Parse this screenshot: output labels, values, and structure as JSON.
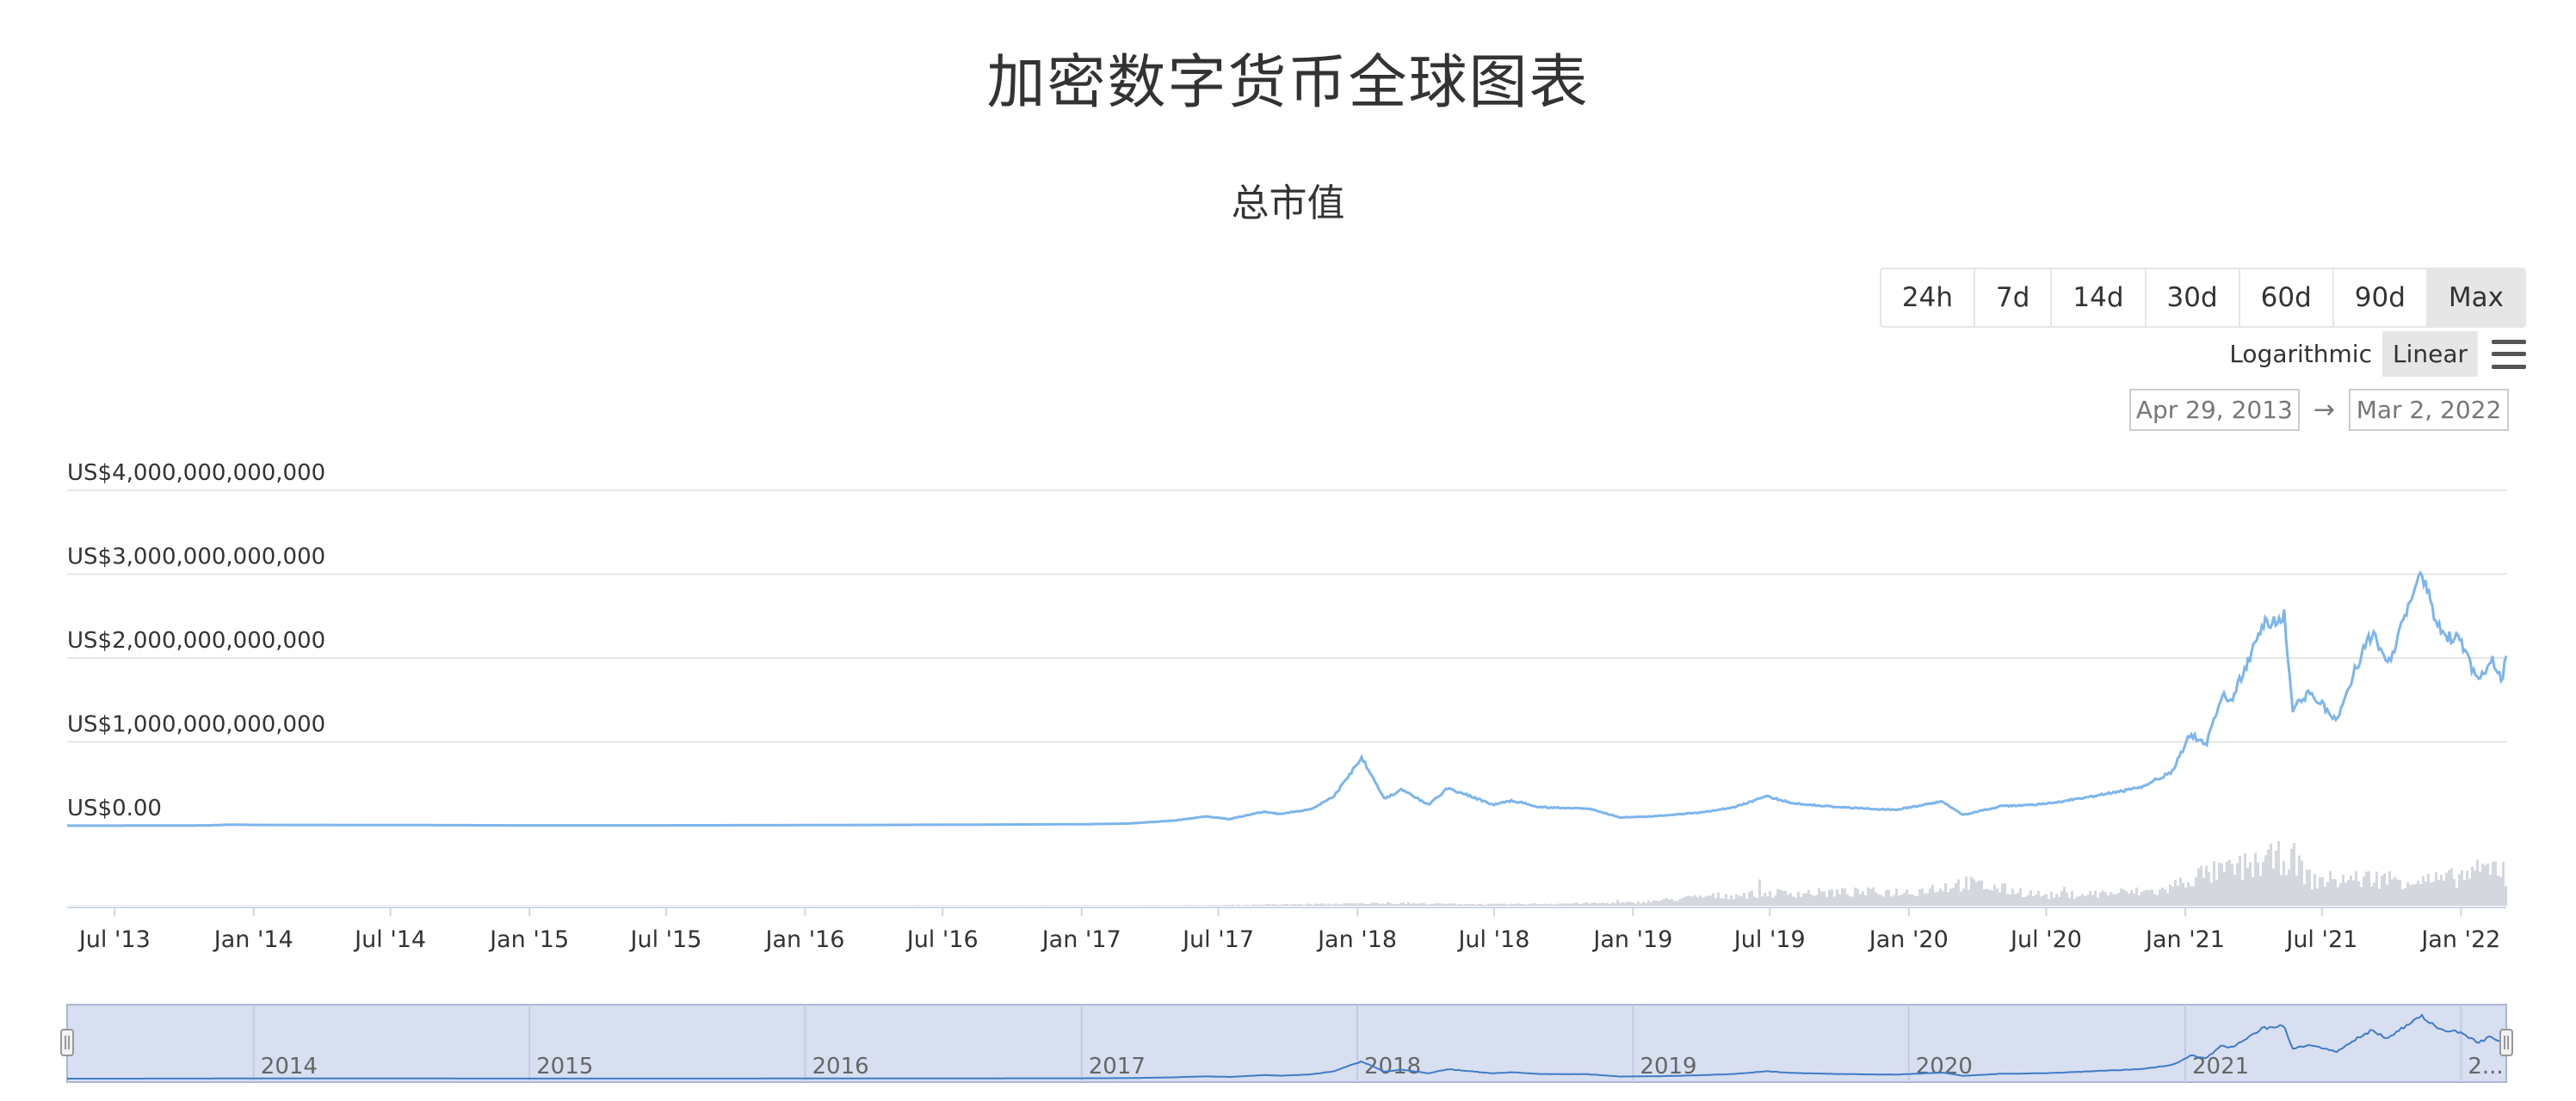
{
  "page": {
    "title": "加密数字货币全球图表"
  },
  "chart_header": {
    "subtitle": "总市值"
  },
  "range_buttons": [
    "24h",
    "7d",
    "14d",
    "30d",
    "60d",
    "90d",
    "Max"
  ],
  "active_range": "Max",
  "scale": {
    "log_label": "Logarithmic",
    "linear_label": "Linear",
    "active": "Linear"
  },
  "date_range": {
    "from": "Apr 29, 2013",
    "arrow": "→",
    "to": "Mar 2, 2022"
  },
  "colors": {
    "line": "#7cb5ec",
    "volume": "#d4d7de",
    "navigator_fill": "#d8dff0",
    "navigator_border": "#a9b7d6"
  },
  "chart_data": {
    "type": "area",
    "title": "总市值",
    "y_tick_labels": [
      "US$0.00",
      "US$1,000,000,000,000",
      "US$2,000,000,000,000",
      "US$3,000,000,000,000",
      "US$4,000,000,000,000"
    ],
    "y_ticks": [
      0,
      1000000000000,
      2000000000000,
      3000000000000,
      4000000000000
    ],
    "ylim": [
      0,
      4000000000000
    ],
    "x_range": [
      "2013-04-29",
      "2022-03-02"
    ],
    "x_tick_labels": [
      {
        "label": "Jul '13",
        "date": "2013-07-01"
      },
      {
        "label": "Jan '14",
        "date": "2014-01-01"
      },
      {
        "label": "Jul '14",
        "date": "2014-07-01"
      },
      {
        "label": "Jan '15",
        "date": "2015-01-01"
      },
      {
        "label": "Jul '15",
        "date": "2015-07-01"
      },
      {
        "label": "Jan '16",
        "date": "2016-01-01"
      },
      {
        "label": "Jul '16",
        "date": "2016-07-01"
      },
      {
        "label": "Jan '17",
        "date": "2017-01-01"
      },
      {
        "label": "Jul '17",
        "date": "2017-07-01"
      },
      {
        "label": "Jan '18",
        "date": "2018-01-01"
      },
      {
        "label": "Jul '18",
        "date": "2018-07-01"
      },
      {
        "label": "Jan '19",
        "date": "2019-01-01"
      },
      {
        "label": "Jul '19",
        "date": "2019-07-01"
      },
      {
        "label": "Jan '20",
        "date": "2020-01-01"
      },
      {
        "label": "Jul '20",
        "date": "2020-07-01"
      },
      {
        "label": "Jan '21",
        "date": "2021-01-01"
      },
      {
        "label": "Jul '21",
        "date": "2021-07-01"
      },
      {
        "label": "Jan '22",
        "date": "2022-01-01"
      }
    ],
    "navigator_labels": [
      {
        "label": "2014",
        "date": "2014-01-01"
      },
      {
        "label": "2015",
        "date": "2015-01-01"
      },
      {
        "label": "2016",
        "date": "2016-01-01"
      },
      {
        "label": "2017",
        "date": "2017-01-01"
      },
      {
        "label": "2018",
        "date": "2018-01-01"
      },
      {
        "label": "2019",
        "date": "2019-01-01"
      },
      {
        "label": "2020",
        "date": "2020-01-01"
      },
      {
        "label": "2021",
        "date": "2021-01-01"
      },
      {
        "label": "2...",
        "date": "2022-01-01"
      }
    ],
    "series": [
      {
        "points": [
          [
            "2013-04-29",
            1500000000
          ],
          [
            "2013-07-01",
            1200000000
          ],
          [
            "2013-11-01",
            4000000000
          ],
          [
            "2013-12-04",
            14000000000
          ],
          [
            "2014-01-01",
            10000000000
          ],
          [
            "2014-07-01",
            8000000000
          ],
          [
            "2015-01-01",
            4000000000
          ],
          [
            "2015-07-01",
            4500000000
          ],
          [
            "2016-01-01",
            7000000000
          ],
          [
            "2016-07-01",
            12000000000
          ],
          [
            "2017-01-01",
            18000000000
          ],
          [
            "2017-03-01",
            25000000000
          ],
          [
            "2017-05-01",
            60000000000
          ],
          [
            "2017-06-15",
            110000000000
          ],
          [
            "2017-07-15",
            80000000000
          ],
          [
            "2017-09-01",
            170000000000
          ],
          [
            "2017-09-20",
            140000000000
          ],
          [
            "2017-11-01",
            200000000000
          ],
          [
            "2017-12-01",
            350000000000
          ],
          [
            "2018-01-07",
            820000000000
          ],
          [
            "2018-02-06",
            320000000000
          ],
          [
            "2018-03-01",
            430000000000
          ],
          [
            "2018-04-05",
            250000000000
          ],
          [
            "2018-05-01",
            450000000000
          ],
          [
            "2018-06-30",
            250000000000
          ],
          [
            "2018-07-25",
            300000000000
          ],
          [
            "2018-09-01",
            220000000000
          ],
          [
            "2018-11-01",
            210000000000
          ],
          [
            "2018-12-15",
            100000000000
          ],
          [
            "2019-02-01",
            115000000000
          ],
          [
            "2019-04-01",
            160000000000
          ],
          [
            "2019-05-15",
            220000000000
          ],
          [
            "2019-06-26",
            350000000000
          ],
          [
            "2019-08-01",
            270000000000
          ],
          [
            "2019-10-01",
            220000000000
          ],
          [
            "2019-12-15",
            190000000000
          ],
          [
            "2020-02-15",
            290000000000
          ],
          [
            "2020-03-13",
            130000000000
          ],
          [
            "2020-05-01",
            230000000000
          ],
          [
            "2020-07-01",
            260000000000
          ],
          [
            "2020-09-01",
            350000000000
          ],
          [
            "2020-11-01",
            450000000000
          ],
          [
            "2020-12-15",
            650000000000
          ],
          [
            "2021-01-08",
            1100000000000
          ],
          [
            "2021-01-28",
            950000000000
          ],
          [
            "2021-02-20",
            1600000000000
          ],
          [
            "2021-03-01",
            1450000000000
          ],
          [
            "2021-04-15",
            2400000000000
          ],
          [
            "2021-05-12",
            2500000000000
          ],
          [
            "2021-05-23",
            1400000000000
          ],
          [
            "2021-06-15",
            1600000000000
          ],
          [
            "2021-07-20",
            1250000000000
          ],
          [
            "2021-08-20",
            2000000000000
          ],
          [
            "2021-09-06",
            2300000000000
          ],
          [
            "2021-09-25",
            1900000000000
          ],
          [
            "2021-11-09",
            3000000000000
          ],
          [
            "2021-12-05",
            2300000000000
          ],
          [
            "2021-12-31",
            2200000000000
          ],
          [
            "2022-01-24",
            1700000000000
          ],
          [
            "2022-02-10",
            2000000000000
          ],
          [
            "2022-02-24",
            1750000000000
          ],
          [
            "2022-03-02",
            2000000000000
          ]
        ]
      }
    ],
    "volume": {
      "points": [
        [
          "2013-04-29",
          0.002
        ],
        [
          "2017-06-01",
          0.01
        ],
        [
          "2017-12-15",
          0.04
        ],
        [
          "2018-02-01",
          0.05
        ],
        [
          "2018-07-01",
          0.03
        ],
        [
          "2019-01-01",
          0.06
        ],
        [
          "2019-04-01",
          0.18
        ],
        [
          "2019-07-01",
          0.25
        ],
        [
          "2020-01-01",
          0.28
        ],
        [
          "2020-03-13",
          0.45
        ],
        [
          "2020-07-01",
          0.2
        ],
        [
          "2020-12-01",
          0.3
        ],
        [
          "2021-01-15",
          0.6
        ],
        [
          "2021-02-25",
          0.7
        ],
        [
          "2021-05-19",
          1.0
        ],
        [
          "2021-06-15",
          0.5
        ],
        [
          "2021-09-07",
          0.55
        ],
        [
          "2021-12-04",
          0.5
        ],
        [
          "2022-02-24",
          0.8
        ],
        [
          "2022-03-02",
          0.35
        ]
      ]
    }
  }
}
